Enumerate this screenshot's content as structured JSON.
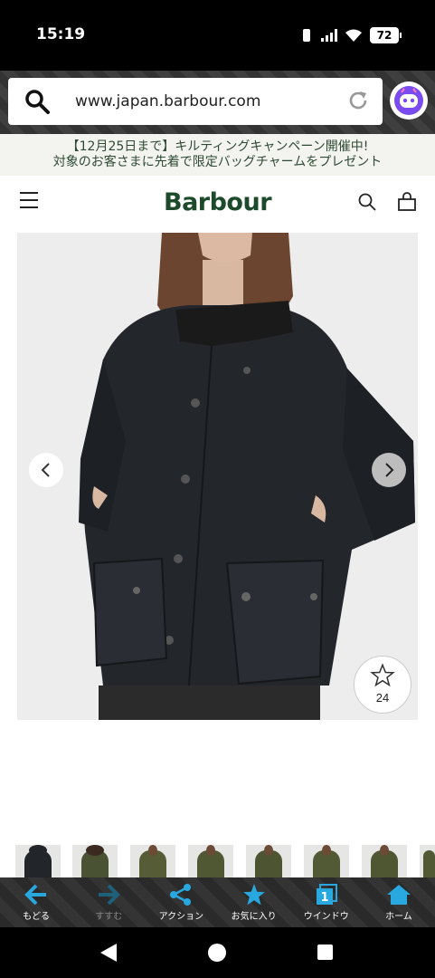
{
  "status_bar": {
    "time": "15:19",
    "battery": "72"
  },
  "browser": {
    "url": "www.japan.barbour.com"
  },
  "promo": {
    "line1": "【12月25日まで】キルティングキャンペーン開催中!",
    "line2": "対象のお客さまに先着で限定バッグチャームをプレゼント"
  },
  "site": {
    "logo": "Barbour"
  },
  "product": {
    "favorite_count": "24",
    "thumbnail_count": 8
  },
  "toolbar": {
    "back_label": "もどる",
    "forward_label": "すすむ",
    "action_label": "アクション",
    "favorites_label": "お気に入り",
    "window_label": "ウインドウ",
    "window_count": "1",
    "home_label": "ホーム"
  },
  "colors": {
    "brand": "#1d4a2a",
    "toolbar_icon": "#29a8e0",
    "jacket": "#23262b"
  }
}
